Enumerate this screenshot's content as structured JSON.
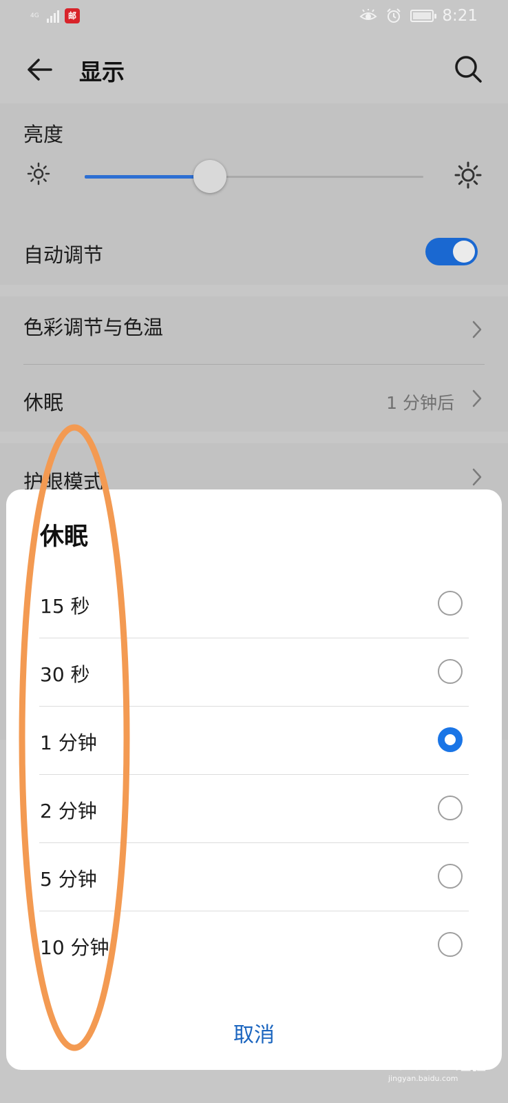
{
  "status_bar": {
    "network": "4G",
    "app_badge": "邮",
    "time": "8:21",
    "icons": [
      "signal-icon",
      "eye-comfort-icon",
      "alarm-icon",
      "battery-charging-icon"
    ]
  },
  "app_bar": {
    "title": "显示",
    "back_icon": "back-arrow-icon",
    "search_icon": "search-icon"
  },
  "brightness": {
    "label": "亮度",
    "level_fraction": 0.37,
    "accent": "#2d6fd3"
  },
  "auto_adjust": {
    "label": "自动调节",
    "enabled": true
  },
  "rows": {
    "color_temp": "色彩调节与色温",
    "sleep": "休眠",
    "sleep_value": "1 分钟后",
    "eye_mode": "护眼模式"
  },
  "dialog": {
    "title": "休眠",
    "options": [
      {
        "label": "15 秒",
        "selected": false
      },
      {
        "label": "30 秒",
        "selected": false
      },
      {
        "label": "1 分钟",
        "selected": true
      },
      {
        "label": "2 分钟",
        "selected": false
      },
      {
        "label": "5 分钟",
        "selected": false
      },
      {
        "label": "10 分钟",
        "selected": false
      }
    ],
    "cancel": "取消"
  },
  "annotation": {
    "color": "#f39a52"
  },
  "watermark": {
    "brand": "Baidu",
    "product": "经验",
    "url": "jingyan.baidu.com"
  }
}
